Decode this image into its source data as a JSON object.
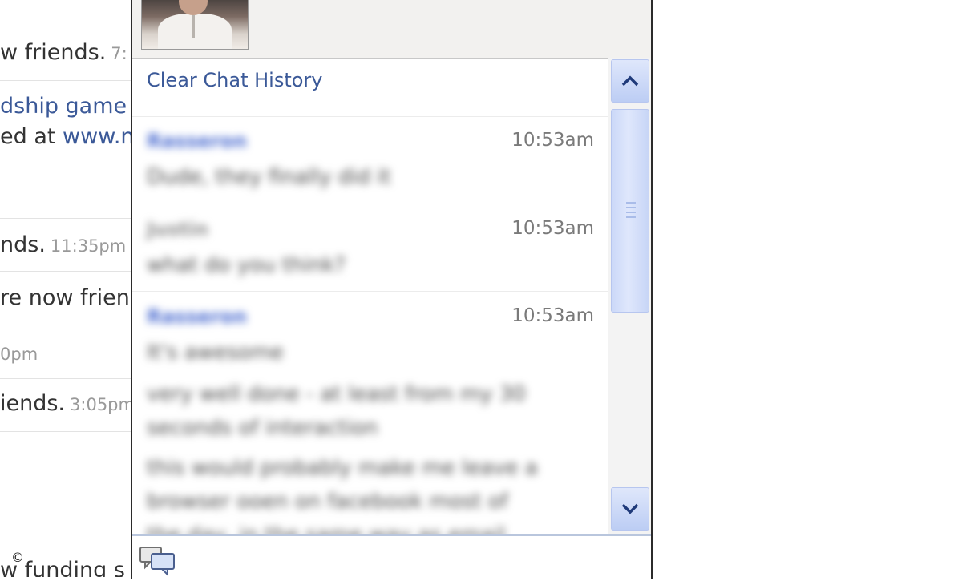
{
  "feed": {
    "items": [
      {
        "text": "w friends.",
        "time": "7:"
      },
      {
        "link_text": "dship game li"
      },
      {
        "text": "ed at ",
        "link_text": "www.n"
      },
      {
        "text": "nds.",
        "time": "11:35pm"
      },
      {
        "text": "re now frienc"
      },
      {
        "time": "0pm"
      },
      {
        "text": "iends.",
        "time": "3:05pm"
      },
      {
        "text": "w funding s"
      }
    ]
  },
  "chat": {
    "clear_history": "Clear Chat History",
    "messages": [
      {
        "sender": "Rasseron",
        "time": "10:53am",
        "lines": [
          "Dude, they finally did it"
        ]
      },
      {
        "sender": "Justin",
        "time": "10:53am",
        "lines": [
          "what do you think?"
        ]
      },
      {
        "sender": "Rasseron",
        "time": "10:53am",
        "lines": [
          "It's awesome",
          "very well done - at least from my 30",
          "seconds of interaction",
          "this would probably make me leave a",
          "browser ooen on facebook most of",
          "the day, in the same way as email"
        ]
      }
    ]
  },
  "colors": {
    "link": "#3b5998",
    "scrollbar": "#bccdf4",
    "window_border": "#2b2b2b"
  },
  "icons": {
    "scroll_up": "chevron-up-icon",
    "scroll_down": "chevron-down-icon",
    "chat": "chat-bubbles-icon"
  },
  "watermark": "©"
}
